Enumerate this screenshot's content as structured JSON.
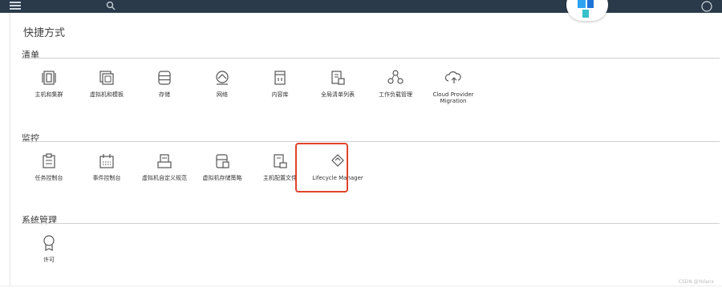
{
  "page_title": "快捷方式",
  "sections": [
    {
      "title": "清单",
      "items": [
        {
          "label": "主机和集群",
          "icon": "hosts-clusters-icon"
        },
        {
          "label": "虚拟机和模板",
          "icon": "vms-templates-icon"
        },
        {
          "label": "存储",
          "icon": "storage-icon"
        },
        {
          "label": "网络",
          "icon": "network-icon"
        },
        {
          "label": "内容库",
          "icon": "content-library-icon"
        },
        {
          "label": "全局清单列表",
          "icon": "global-inventory-icon"
        },
        {
          "label": "工作负载管理",
          "icon": "workload-management-icon"
        },
        {
          "label": "Cloud Provider Migration",
          "icon": "cloud-migration-icon"
        }
      ]
    },
    {
      "title": "监控",
      "items": [
        {
          "label": "任务控制台",
          "icon": "task-console-icon"
        },
        {
          "label": "事件控制台",
          "icon": "event-console-icon"
        },
        {
          "label": "虚拟机自定义规范",
          "icon": "vm-customization-icon"
        },
        {
          "label": "虚拟机存储策略",
          "icon": "vm-storage-policy-icon"
        },
        {
          "label": "主机配置文件",
          "icon": "host-profiles-icon"
        },
        {
          "label": "Lifecycle Manager",
          "icon": "lifecycle-manager-icon"
        }
      ]
    },
    {
      "title": "系统管理",
      "items": [
        {
          "label": "许可",
          "icon": "licensing-icon"
        }
      ]
    }
  ],
  "watermark": "CSDN @Yolanx",
  "colors": {
    "topbar": "#2b3a4a",
    "highlight": "#e0442b",
    "icon_stroke": "#555555"
  }
}
